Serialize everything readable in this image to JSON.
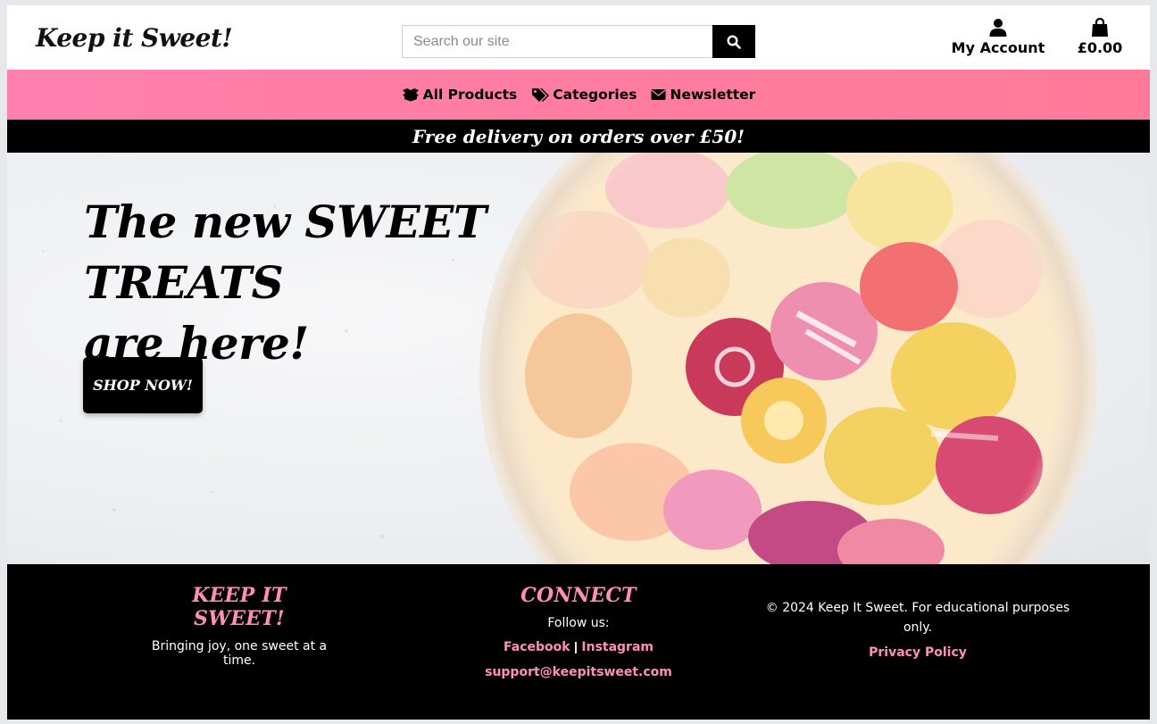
{
  "header": {
    "logo": "Keep it Sweet!",
    "search_placeholder": "Search our site",
    "search_value": "",
    "account_label": "My Account",
    "bag_total": "£0.00"
  },
  "nav": {
    "items": [
      {
        "label": "All Products",
        "icon": "boxes-icon"
      },
      {
        "label": "Categories",
        "icon": "tags-icon"
      },
      {
        "label": "Newsletter",
        "icon": "envelope-icon"
      }
    ]
  },
  "promo": {
    "text": "Free delivery on orders over £50!"
  },
  "hero": {
    "title_line1": "The new SWEET TREATS",
    "title_line2": "are here!",
    "cta_label": "SHOP NOW!"
  },
  "footer": {
    "brand": {
      "heading": "KEEP IT SWEET!",
      "tagline": "Bringing joy, one sweet at a time."
    },
    "connect": {
      "heading": "CONNECT",
      "follow_label": "Follow us:",
      "facebook": "Facebook",
      "separator": "|",
      "instagram": "Instagram",
      "email": "support@keepitsweet.com"
    },
    "legal": {
      "copyright": "© 2024 Keep It Sweet. For educational purposes only.",
      "privacy": "Privacy Policy"
    }
  },
  "colors": {
    "accent_pink": "#ff8fb8",
    "nav_gradient_start": "#ff80ad",
    "nav_gradient_end": "#ff7a98",
    "black": "#000000"
  }
}
